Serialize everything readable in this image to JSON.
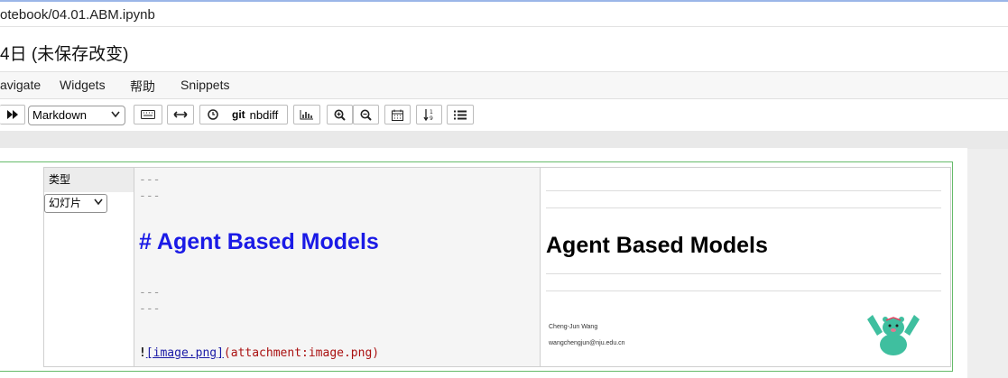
{
  "browser": {
    "url": "otebook/04.01.ABM.ipynb"
  },
  "notebook": {
    "title": "4日  (未保存改变)"
  },
  "menu": {
    "items": [
      "avigate",
      "Widgets",
      "帮助",
      "Snippets"
    ]
  },
  "toolbar": {
    "cell_type": "Markdown",
    "git_label": "git",
    "nbdiff_label": "nbdiff"
  },
  "cell": {
    "slide_label": "类型",
    "slide_type": "幻灯片",
    "source": {
      "rule1": "---",
      "rule2": "---",
      "heading": "# Agent Based Models",
      "rule3": "---",
      "rule4": "---",
      "img_bang": "!",
      "img_link": "[image.png]",
      "img_target": "(attachment:image.png)"
    },
    "rendered": {
      "heading": "Agent Based Models",
      "author": "Cheng-Jun Wang",
      "email": "wangchengjun@nju.edu.cn"
    }
  },
  "colors": {
    "accent_heading": "#1a1ae6",
    "cell_border": "#66bb6a",
    "link": "#1a1aa6",
    "attachment": "#a11"
  }
}
